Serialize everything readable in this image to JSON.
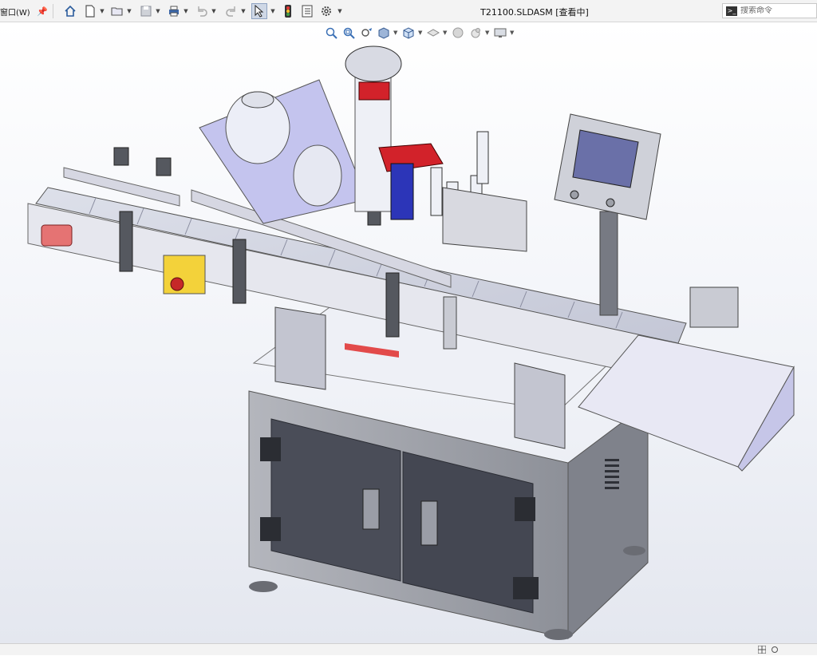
{
  "menu": {
    "window_label": "窗口(W)"
  },
  "toolbar": {
    "buttons": [
      "home-icon",
      "new-document-icon",
      "open-folder-icon",
      "save-icon",
      "print-icon",
      "undo-icon",
      "redo-icon",
      "select-pointer-icon",
      "traffic-light-icon",
      "file-properties-icon",
      "gear-icon"
    ]
  },
  "window": {
    "title": "T21100.SLDASM [查看中]"
  },
  "search": {
    "placeholder": "搜索命令"
  },
  "viewbar": {
    "buttons": [
      "zoom-to-fit-icon",
      "zoom-to-area-icon",
      "previous-view-icon",
      "section-view-icon",
      "view-orientation-icon",
      "display-style-icon",
      "hide-show-icon",
      "appearance-icon",
      "scene-icon",
      "view-settings-icon"
    ]
  },
  "model": {
    "name": "labeling-machine-assembly"
  },
  "colors": {
    "accent": "#d2222a",
    "panel": "#3f4350",
    "frame": "#a0a3ab",
    "conveyor": "#c9cbd8",
    "lavender": "#b8b8e6"
  }
}
